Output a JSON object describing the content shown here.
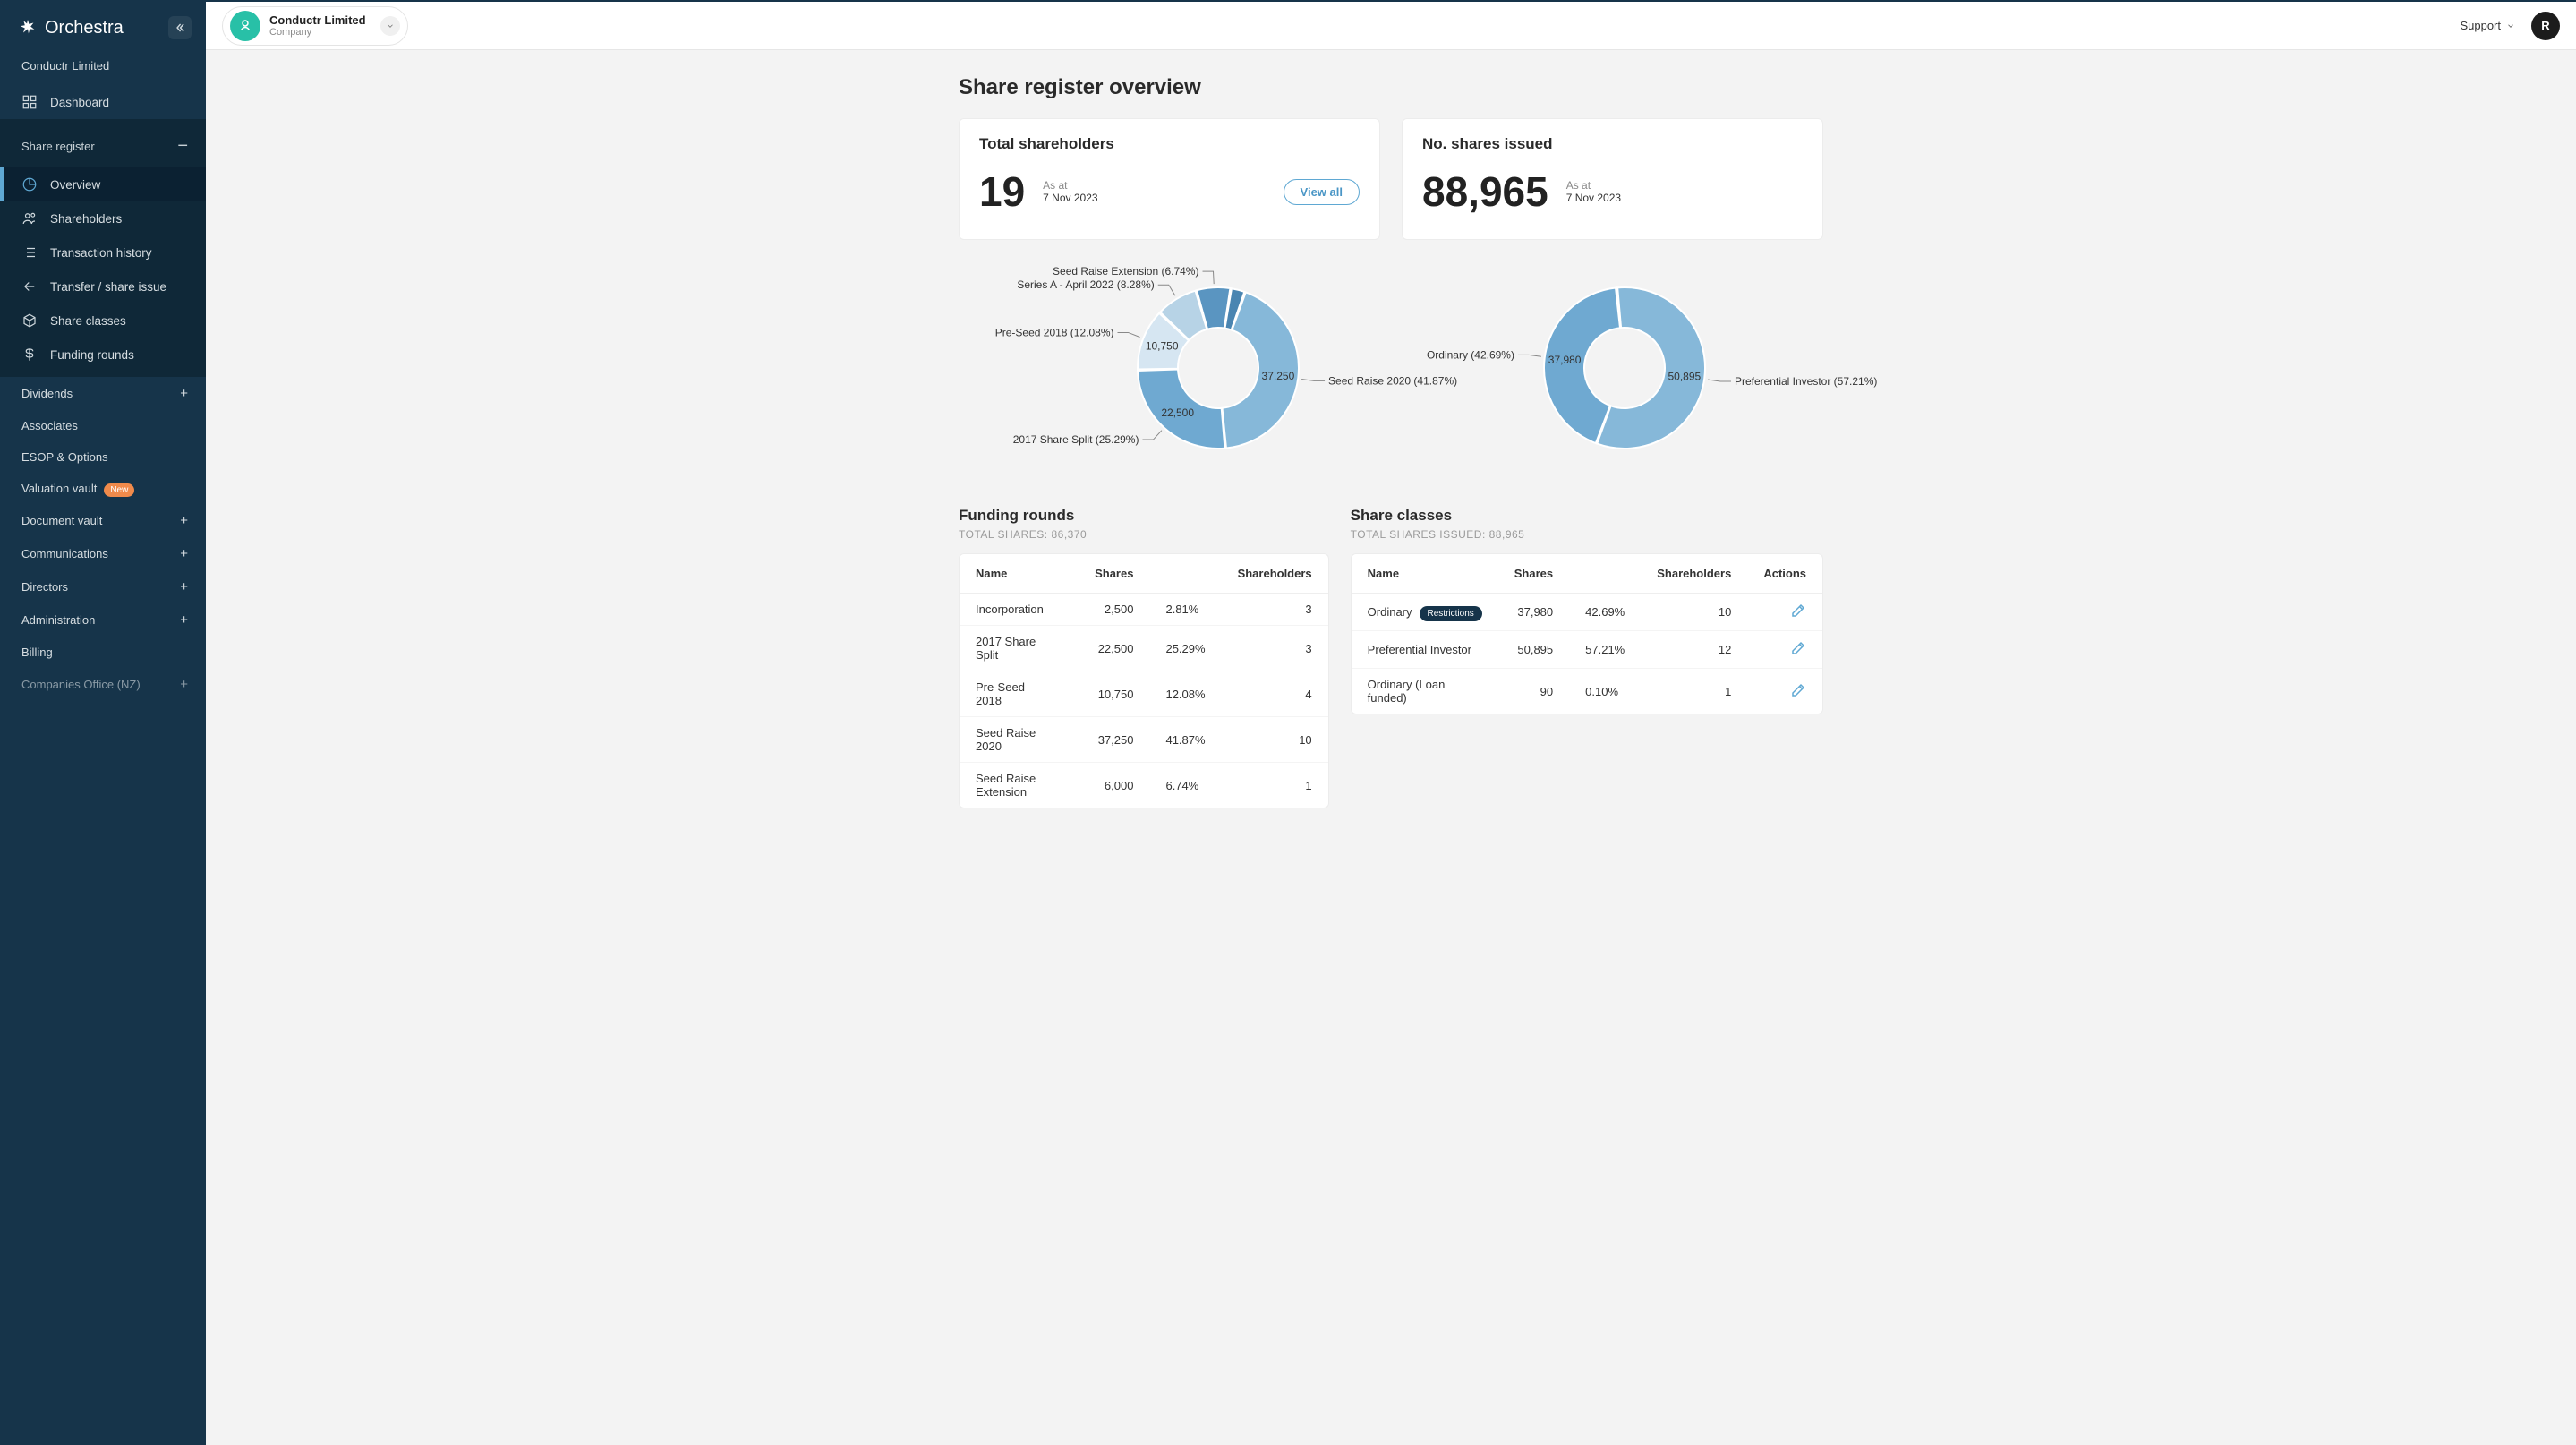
{
  "brand": "Orchestra",
  "company": {
    "name": "Conductr Limited",
    "type": "Company"
  },
  "topbar": {
    "support": "Support",
    "user_initial": "R"
  },
  "sidebar": {
    "company_label": "Conductr Limited",
    "dashboard": "Dashboard",
    "share_register": "Share register",
    "sub": {
      "overview": "Overview",
      "shareholders": "Shareholders",
      "transaction_history": "Transaction history",
      "transfer_issue": "Transfer / share issue",
      "share_classes": "Share classes",
      "funding_rounds": "Funding rounds"
    },
    "lower": {
      "dividends": "Dividends",
      "associates": "Associates",
      "esop": "ESOP & Options",
      "valuation_vault": "Valuation vault",
      "new_badge": "New",
      "document_vault": "Document vault",
      "communications": "Communications",
      "directors": "Directors",
      "administration": "Administration",
      "billing": "Billing",
      "companies_office": "Companies Office (NZ)"
    }
  },
  "page": {
    "title": "Share register overview"
  },
  "cards": {
    "shareholders": {
      "title": "Total shareholders",
      "value": "19",
      "asat_label": "As at",
      "asat": "7 Nov 2023",
      "view_all": "View all"
    },
    "shares_issued": {
      "title": "No. shares issued",
      "value": "88,965",
      "asat_label": "As at",
      "asat": "7 Nov 2023"
    }
  },
  "chart_data": [
    {
      "type": "pie",
      "variant": "donut",
      "title": "",
      "series": [
        {
          "name": "Seed Raise 2020",
          "label": "Seed Raise 2020 (41.87%)",
          "value": 37250,
          "pct": 41.87,
          "color": "#86b8d9"
        },
        {
          "name": "2017 Share Split",
          "label": "2017 Share Split (25.29%)",
          "value": 22500,
          "pct": 25.29,
          "color": "#6fa9d1"
        },
        {
          "name": "Pre-Seed 2018",
          "label": "Pre-Seed 2018 (12.08%)",
          "value": 10750,
          "pct": 12.08,
          "color": "#d6e6f2"
        },
        {
          "name": "Series A - April 2022",
          "label": "Series A - April 2022 (8.28%)",
          "value": 7370,
          "pct": 8.28,
          "color": "#b7d3e6"
        },
        {
          "name": "Seed Raise Extension",
          "label": "Seed Raise Extension (6.74%)",
          "value": 6000,
          "pct": 6.74,
          "color": "#5a95c1"
        },
        {
          "name": "Incorporation",
          "label": "",
          "value": 2500,
          "pct": 2.81,
          "color": "#4a85b1"
        }
      ],
      "value_labels_shown": [
        "37,250",
        "22,500",
        "10,750"
      ]
    },
    {
      "type": "pie",
      "variant": "donut",
      "title": "",
      "series": [
        {
          "name": "Preferential Investor",
          "label": "Preferential Investor (57.21%)",
          "value": 50895,
          "pct": 57.21,
          "color": "#86b8d9"
        },
        {
          "name": "Ordinary",
          "label": "Ordinary (42.69%)",
          "value": 37980,
          "pct": 42.69,
          "color": "#6fa9d1"
        },
        {
          "name": "Ordinary (Loan funded)",
          "label": "",
          "value": 90,
          "pct": 0.1,
          "color": "#4a85b1"
        }
      ],
      "value_labels_shown": [
        "50,895",
        "37,980"
      ]
    }
  ],
  "funding_rounds": {
    "title": "Funding rounds",
    "subtitle": "TOTAL SHARES: 86,370",
    "columns": [
      "Name",
      "Shares",
      "Shareholders"
    ],
    "rows": [
      {
        "name": "Incorporation",
        "shares": "2,500",
        "pct": "2.81%",
        "holders": "3"
      },
      {
        "name": "2017 Share Split",
        "shares": "22,500",
        "pct": "25.29%",
        "holders": "3"
      },
      {
        "name": "Pre-Seed 2018",
        "shares": "10,750",
        "pct": "12.08%",
        "holders": "4"
      },
      {
        "name": "Seed Raise 2020",
        "shares": "37,250",
        "pct": "41.87%",
        "holders": "10"
      },
      {
        "name": "Seed Raise Extension",
        "shares": "6,000",
        "pct": "6.74%",
        "holders": "1"
      }
    ]
  },
  "share_classes": {
    "title": "Share classes",
    "subtitle": "TOTAL SHARES ISSUED: 88,965",
    "columns": [
      "Name",
      "Shares",
      "Shareholders",
      "Actions"
    ],
    "restrictions_label": "Restrictions",
    "rows": [
      {
        "name": "Ordinary",
        "badge": true,
        "shares": "37,980",
        "pct": "42.69%",
        "holders": "10"
      },
      {
        "name": "Preferential Investor",
        "badge": false,
        "shares": "50,895",
        "pct": "57.21%",
        "holders": "12"
      },
      {
        "name": "Ordinary (Loan funded)",
        "badge": false,
        "shares": "90",
        "pct": "0.10%",
        "holders": "1"
      }
    ]
  }
}
